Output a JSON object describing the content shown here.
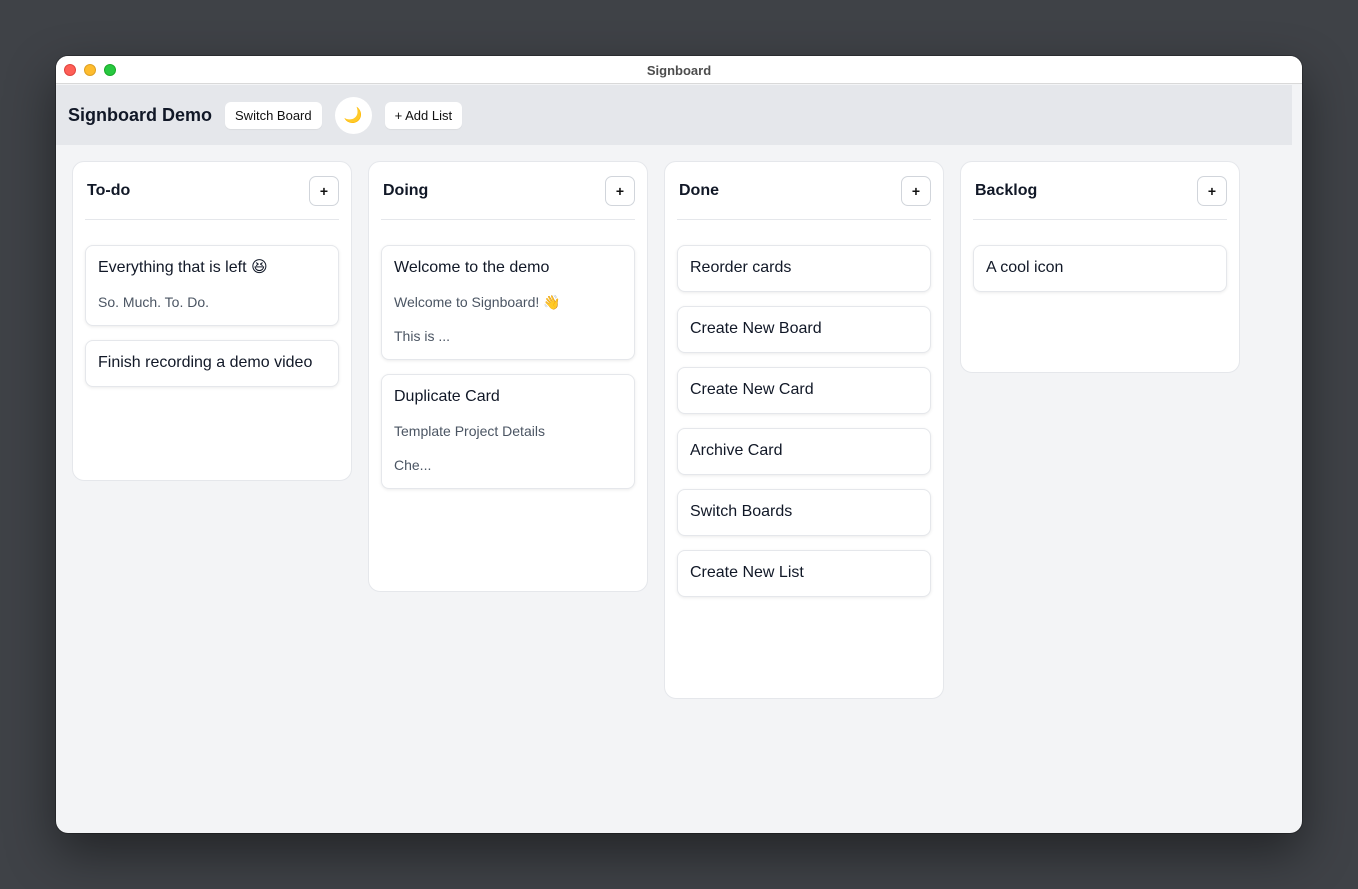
{
  "window": {
    "title": "Signboard"
  },
  "header": {
    "board_title": "Signboard Demo",
    "switch_board_label": "Switch Board",
    "theme_icon": "🌙",
    "add_list_label": "+ Add List"
  },
  "lists": [
    {
      "title": "To-do",
      "add_label": "+",
      "cards": [
        {
          "title": "Everything that is left 😆",
          "desc": [
            "So. Much. To. Do."
          ]
        },
        {
          "title": "Finish recording a demo video"
        }
      ]
    },
    {
      "title": "Doing",
      "add_label": "+",
      "cards": [
        {
          "title": "Welcome to the demo",
          "desc": [
            "Welcome to Signboard! 👋",
            "This is ..."
          ]
        },
        {
          "title": "Duplicate Card",
          "desc": [
            "Template Project Details",
            "Che..."
          ]
        }
      ]
    },
    {
      "title": "Done",
      "add_label": "+",
      "cards": [
        {
          "title": "Reorder cards"
        },
        {
          "title": "Create New Board"
        },
        {
          "title": "Create New Card"
        },
        {
          "title": "Archive Card"
        },
        {
          "title": "Switch Boards"
        },
        {
          "title": "Create New List"
        }
      ]
    },
    {
      "title": "Backlog",
      "add_label": "+",
      "cards": [
        {
          "title": "A cool icon"
        }
      ]
    }
  ]
}
